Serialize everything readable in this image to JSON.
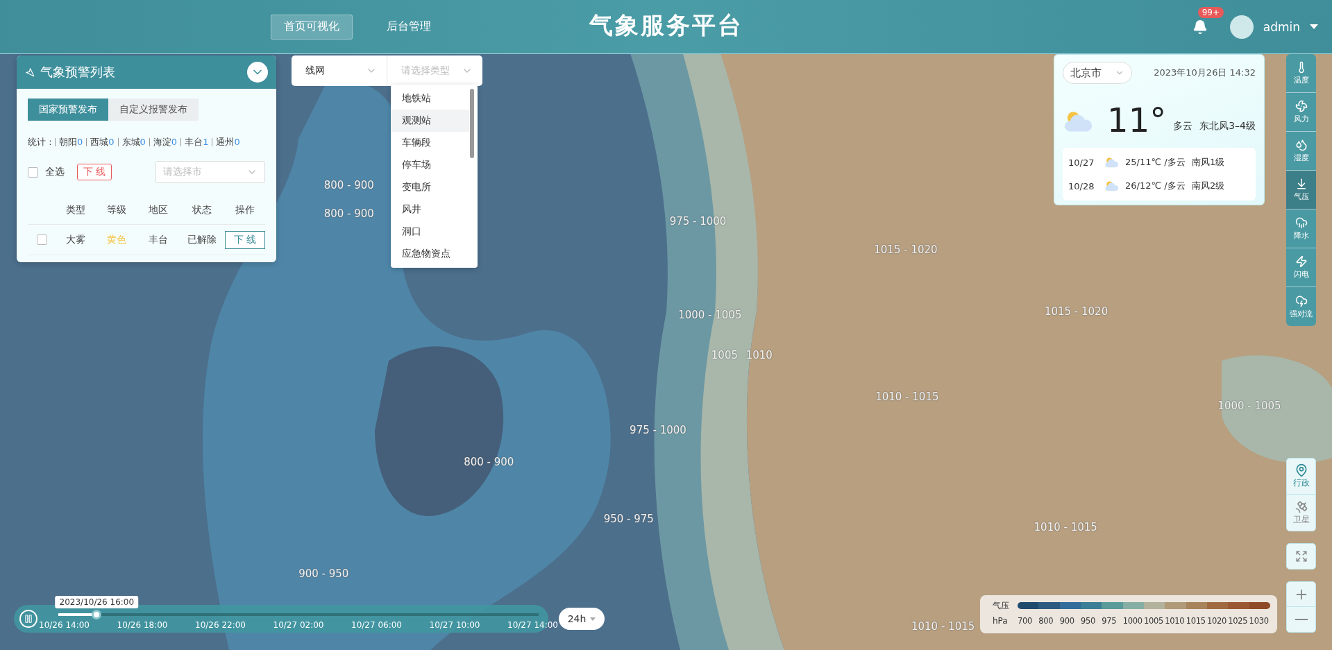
{
  "header": {
    "nav": [
      {
        "label": "首页可视化",
        "selected": true
      },
      {
        "label": "后台管理",
        "selected": false
      }
    ],
    "title": "气象服务平台",
    "notifications": "99+",
    "user": "admin"
  },
  "warning_panel": {
    "title": "气象预警列表",
    "expanded": true,
    "tabs": [
      {
        "label": "国家预警发布",
        "selected": true
      },
      {
        "label": "自定义报警发布",
        "selected": false
      }
    ],
    "stats_label": "统计：",
    "stats": [
      {
        "name": "朝阳",
        "count": "0"
      },
      {
        "name": "西城",
        "count": "0"
      },
      {
        "name": "东城",
        "count": "0"
      },
      {
        "name": "海淀",
        "count": "0"
      },
      {
        "name": "丰台",
        "count": "1"
      },
      {
        "name": "通州",
        "count": "0"
      }
    ],
    "select_all": {
      "label": "全选",
      "checked": false
    },
    "offline_button": "下 线",
    "city_select": {
      "placeholder": "请选择市"
    },
    "columns": [
      "类型",
      "等级",
      "地区",
      "状态",
      "操作"
    ],
    "rows": [
      {
        "checked": false,
        "type": "大雾",
        "level": "黄色",
        "color": "#f5c342",
        "area": "丰台",
        "status": "已解除",
        "action": "下 线"
      }
    ]
  },
  "layer_select": {
    "value": "线网",
    "type_placeholder": "请选择类型",
    "options": [
      {
        "label": "地铁站",
        "selected": false
      },
      {
        "label": "观测站",
        "selected": true
      },
      {
        "label": "车辆段",
        "selected": false
      },
      {
        "label": "停车场",
        "selected": false
      },
      {
        "label": "变电所",
        "selected": false
      },
      {
        "label": "风井",
        "selected": false
      },
      {
        "label": "洞口",
        "selected": false
      },
      {
        "label": "应急物资点",
        "selected": false
      }
    ]
  },
  "weather_card": {
    "city": "北京市",
    "datetime": "2023年10月26日 14:32",
    "temperature": "11°",
    "condition": "多云",
    "wind": "东北风3–4级",
    "forecast": [
      {
        "date": "10/27",
        "temp": "25/11℃ /多云",
        "wind": "南风1级"
      },
      {
        "date": "10/28",
        "temp": "26/12℃ /多云",
        "wind": "南风2级"
      }
    ]
  },
  "layer_toolbar": [
    {
      "kind": "temperature",
      "label": "温度",
      "selected": false
    },
    {
      "kind": "wind",
      "label": "风力",
      "selected": false
    },
    {
      "kind": "humidity",
      "label": "湿度",
      "selected": false
    },
    {
      "kind": "pressure",
      "label": "气压",
      "selected": true
    },
    {
      "kind": "rain",
      "label": "降水",
      "selected": false
    },
    {
      "kind": "lightning",
      "label": "闪电",
      "selected": false
    },
    {
      "kind": "storm",
      "label": "强对流",
      "selected": false
    }
  ],
  "base_map": [
    {
      "kind": "admin",
      "label": "行政",
      "selected": true
    },
    {
      "kind": "satellite",
      "label": "卫星",
      "selected": false
    }
  ],
  "contours": [
    "800 - 900",
    "800 - 900",
    "975 - 1000",
    "1015 - 1020",
    "1015 - 1020",
    "1000 - 1005",
    "1005",
    "1010",
    "975 - 1000",
    "1010 - 1015",
    "800 - 900",
    "950 - 975",
    "900 - 950",
    "1010 - 1015",
    "1000 - 1005",
    "1010 - 1015"
  ],
  "timeline": {
    "playing": true,
    "current": "2023/10/26 16:00",
    "level": 0.08,
    "ticks": [
      "10/26 14:00",
      "10/26 18:00",
      "10/26 22:00",
      "10/27 02:00",
      "10/27 06:00",
      "10/27 10:00",
      "10/27 14:00"
    ],
    "range": "24h"
  },
  "legend": {
    "title": "气压",
    "unit": "hPa",
    "stops": [
      {
        "label": "700",
        "color": "#1f4a6e"
      },
      {
        "label": "800",
        "color": "#2c5a80"
      },
      {
        "label": "900",
        "color": "#336b9a"
      },
      {
        "label": "950",
        "color": "#3a7f95"
      },
      {
        "label": "975",
        "color": "#5a9a9a"
      },
      {
        "label": "1000",
        "color": "#86aea4"
      },
      {
        "label": "1005",
        "color": "#b3b29c"
      },
      {
        "label": "1010",
        "color": "#b09a78"
      },
      {
        "label": "1015",
        "color": "#a8845c"
      },
      {
        "label": "1020",
        "color": "#a06a40"
      },
      {
        "label": "1025",
        "color": "#9a5832"
      },
      {
        "label": "1030",
        "color": "#8e4a28"
      }
    ]
  }
}
